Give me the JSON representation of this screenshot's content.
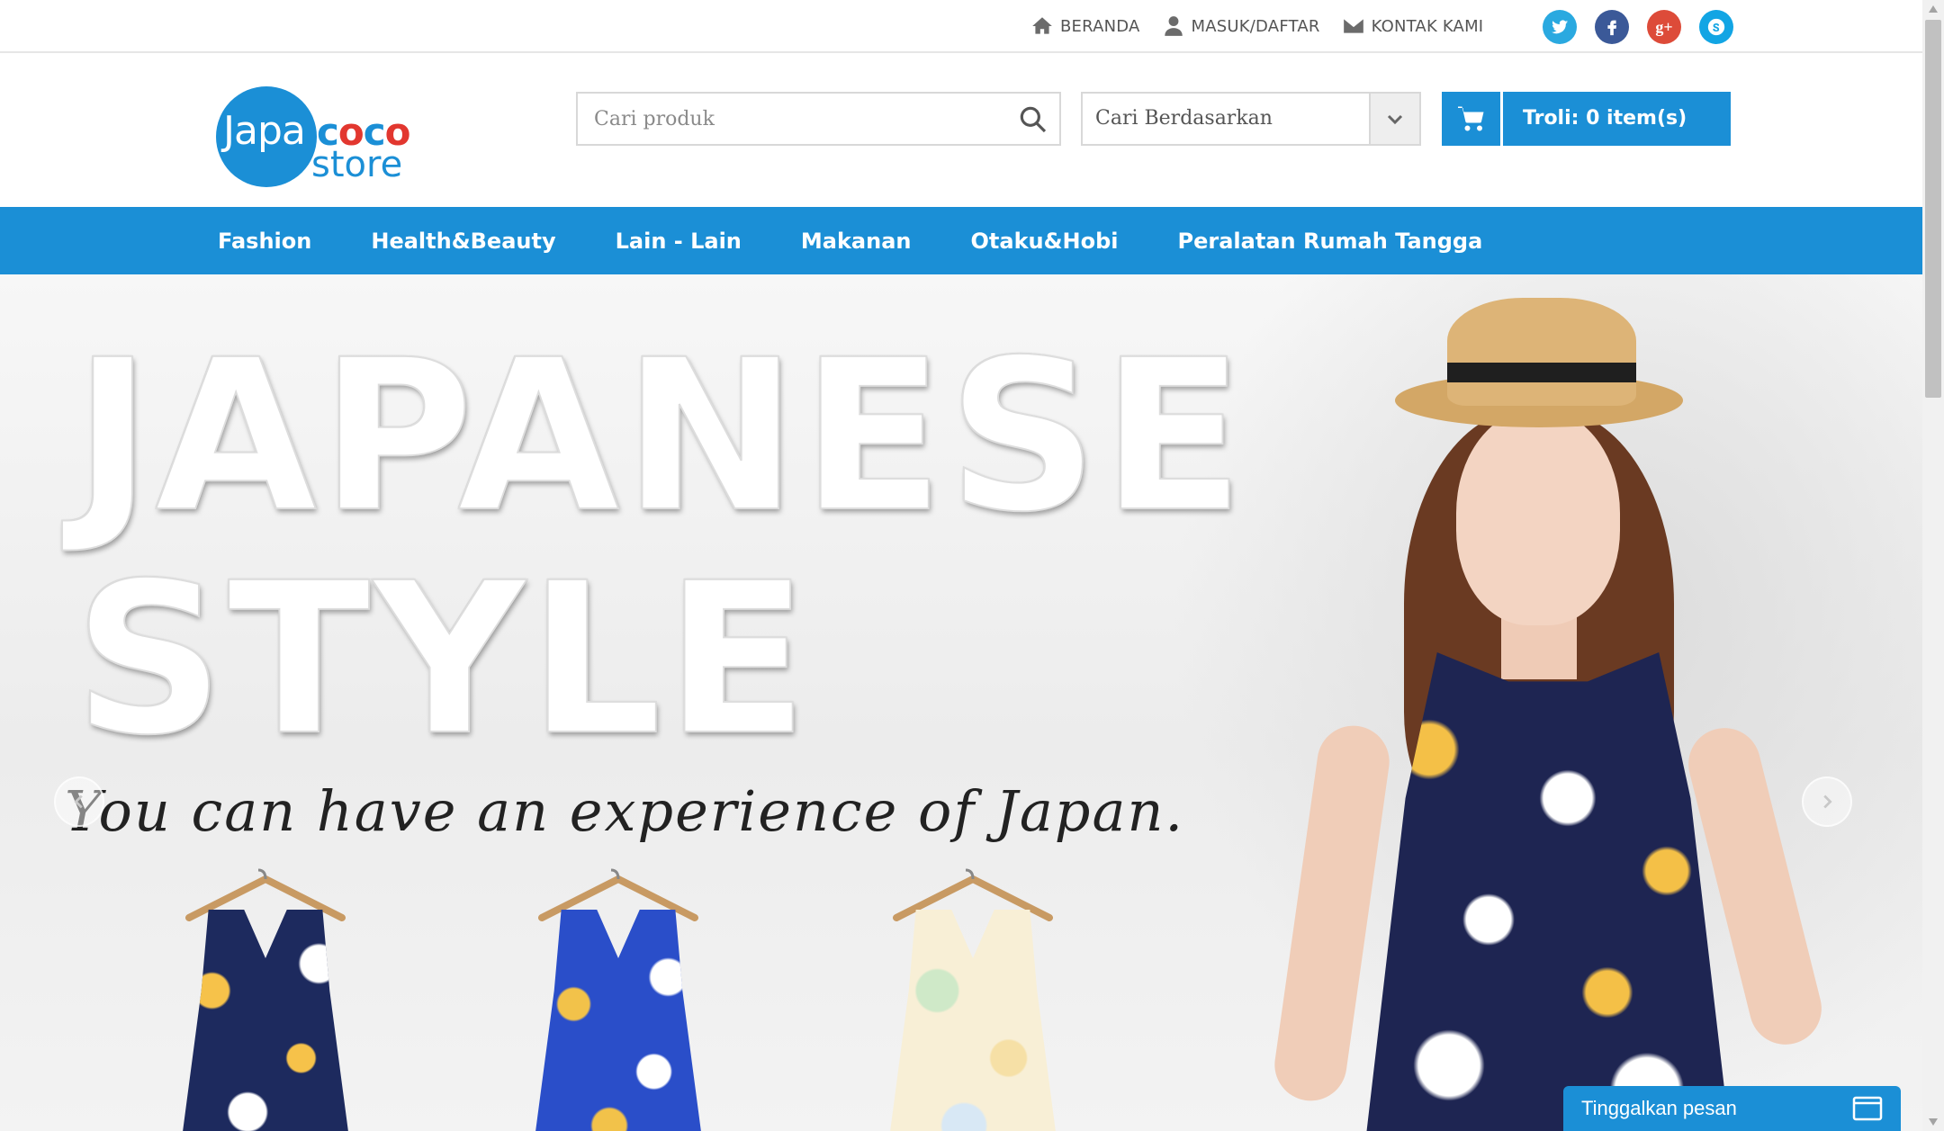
{
  "topbar": {
    "links": [
      {
        "label": "BERANDA",
        "icon": "home-icon"
      },
      {
        "label": "MASUK/DAFTAR",
        "icon": "user-icon"
      },
      {
        "label": "KONTAK KAMI",
        "icon": "mail-icon"
      }
    ],
    "socials": [
      {
        "name": "twitter",
        "icon": "twitter-icon",
        "color": "#2aa9e0"
      },
      {
        "name": "facebook",
        "icon": "facebook-icon",
        "color": "#3b5998"
      },
      {
        "name": "google-plus",
        "icon": "google-plus-icon",
        "color": "#dd4b39",
        "glyph": "g+"
      },
      {
        "name": "skype",
        "icon": "skype-icon",
        "color": "#12a5e4"
      }
    ]
  },
  "logo": {
    "part1": "Japa",
    "part2": "coco",
    "part3": "store"
  },
  "search": {
    "placeholder": "Cari produk",
    "value": ""
  },
  "category_select": {
    "selected": "Cari Berdasarkan"
  },
  "cart": {
    "label": "Troli: 0 item(s)"
  },
  "nav": {
    "items": [
      "Fashion",
      "Health&Beauty",
      "Lain - Lain",
      "Makanan",
      "Otaku&Hobi",
      "Peralatan Rumah Tangga"
    ]
  },
  "hero": {
    "title_line1": "JAPANESE",
    "title_line2": "STYLE",
    "subtitle": "You can have an experience of Japan."
  },
  "chat": {
    "label": "Tinggalkan pesan"
  },
  "colors": {
    "brand_blue": "#1b8fd6",
    "accent_red": "#e2372f"
  }
}
